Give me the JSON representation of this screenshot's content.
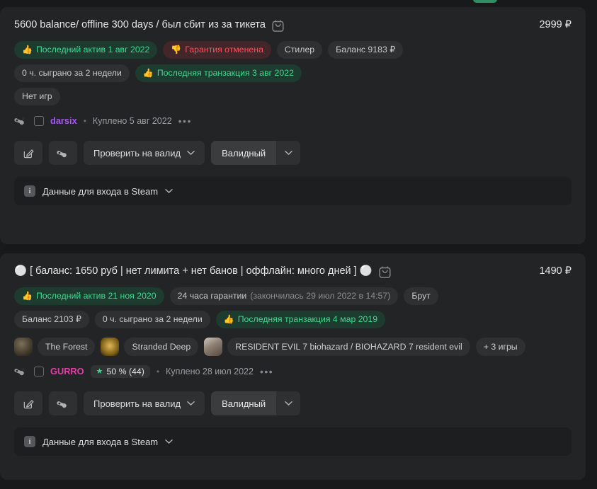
{
  "top_peek": {
    "color": "#2f8f62"
  },
  "cards": [
    {
      "title": "5600 balance/ offline 300 days / был сбит из за тикета",
      "bag_icon": "shopping-bag-icon",
      "price": "2999 ₽",
      "badges_row1": [
        {
          "text": "Последний актив 1 авг 2022",
          "style": "green",
          "icon": "thumbs-up-icon"
        },
        {
          "text": "Гарантия отменена",
          "style": "red",
          "icon": "thumbs-down-icon"
        },
        {
          "text": "Стилер",
          "style": "plain",
          "icon": ""
        },
        {
          "text": "Баланс 9183 ₽",
          "style": "plain",
          "icon": ""
        }
      ],
      "badges_row2": [
        {
          "text": "0 ч. сыграно за 2 недели",
          "style": "plain",
          "icon": ""
        },
        {
          "text": "Последняя транзакция 3 авг 2022",
          "style": "green",
          "icon": "thumbs-up-icon"
        }
      ],
      "badges_row3": [
        {
          "text": "Нет игр",
          "style": "plain",
          "icon": ""
        }
      ],
      "games": [],
      "seller": {
        "steam_icon": "steam-logo-icon",
        "checkbox": "select-checkbox",
        "name": "darsix",
        "name_color": "#a855f7",
        "rating": null,
        "separator": "•",
        "bought": "Куплено 5 авг 2022",
        "more": "•••"
      },
      "actions": {
        "edit_icon": "edit-pencil-icon",
        "steam_icon": "steam-logo-icon",
        "check_label": "Проверить на валид",
        "status_label": "Валидный",
        "caret": "chevron-down-icon"
      },
      "steam_panel": {
        "info_icon": "info-icon",
        "label": "Данные для входа в Steam",
        "caret": "chevron-down-icon"
      }
    },
    {
      "title": "⚪ [ баланс: 1650 руб | нет лимита + нет банов | оффлайн: много дней ] ⚪",
      "bag_icon": "shopping-bag-icon",
      "price": "1490 ₽",
      "badges_row1": [
        {
          "text": "Последний актив 21 ноя 2020",
          "style": "green",
          "icon": "thumbs-up-icon"
        },
        {
          "text": "24 часа гарантии",
          "sub": "(закончилась 29 июл 2022 в 14:57)",
          "style": "plain",
          "icon": ""
        },
        {
          "text": "Брут",
          "style": "plain",
          "icon": ""
        }
      ],
      "badges_row2": [
        {
          "text": "Баланс 2103 ₽",
          "style": "plain",
          "icon": ""
        },
        {
          "text": "0 ч. сыграно за 2 недели",
          "style": "plain",
          "icon": ""
        },
        {
          "text": "Последняя транзакция 4 мар 2019",
          "style": "green",
          "icon": "thumbs-up-icon"
        }
      ],
      "badges_row3": [],
      "games": [
        {
          "name": "The Forest",
          "thumb": "#4a4235"
        },
        {
          "name": "Stranded Deep",
          "thumb": "#6b5320"
        },
        {
          "name": "RESIDENT EVIL 7 biohazard / BIOHAZARD 7 resident evil",
          "thumb": "#9a8f85"
        }
      ],
      "games_more": "+ 3 игры",
      "seller": {
        "steam_icon": "steam-logo-icon",
        "checkbox": "select-checkbox",
        "name": "GURRO",
        "name_color": "#e040a8",
        "rating": {
          "star": "★",
          "text": "50 % (44)"
        },
        "separator": "•",
        "bought": "Куплено 28 июл 2022",
        "more": "•••"
      },
      "actions": {
        "edit_icon": "edit-pencil-icon",
        "steam_icon": "steam-logo-icon",
        "check_label": "Проверить на валид",
        "status_label": "Валидный",
        "caret": "chevron-down-icon"
      },
      "steam_panel": {
        "info_icon": "info-icon",
        "label": "Данные для входа в Steam",
        "caret": "chevron-down-icon"
      }
    }
  ],
  "glyphs": {
    "thumbs_up": "👍",
    "thumbs_down": "👎",
    "info_letter": "i"
  }
}
